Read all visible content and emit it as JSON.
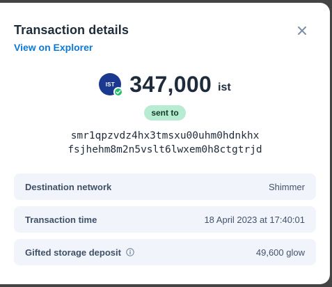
{
  "header": {
    "title": "Transaction details",
    "explorer_link": "View on Explorer",
    "close_icon": "close-icon"
  },
  "amount": {
    "token_symbol_logo": "IST",
    "value": "347,000",
    "unit": "ist",
    "badge_icon": "verified-check-icon"
  },
  "direction_label": "sent to",
  "address": {
    "line1": "smr1qpzvdz4hx3tmsxu00uhm0hdnkhx",
    "line2": "fsjhehm8m2n5vslt6lwxem0h8ctgtrjd"
  },
  "details": [
    {
      "label": "Destination network",
      "value": "Shimmer"
    },
    {
      "label": "Transaction time",
      "value": "18 April 2023 at 17:40:01"
    },
    {
      "label": "Gifted storage deposit",
      "value": "49,600 glow",
      "info_icon": "info-icon"
    }
  ],
  "colors": {
    "accent_link": "#0a79d9",
    "token_logo": "#1b3a8f",
    "verified": "#1fbf6a",
    "pill_bg": "#b8ecd2",
    "row_bg": "#f1f5fb",
    "text_dark": "#1d2b3a"
  }
}
